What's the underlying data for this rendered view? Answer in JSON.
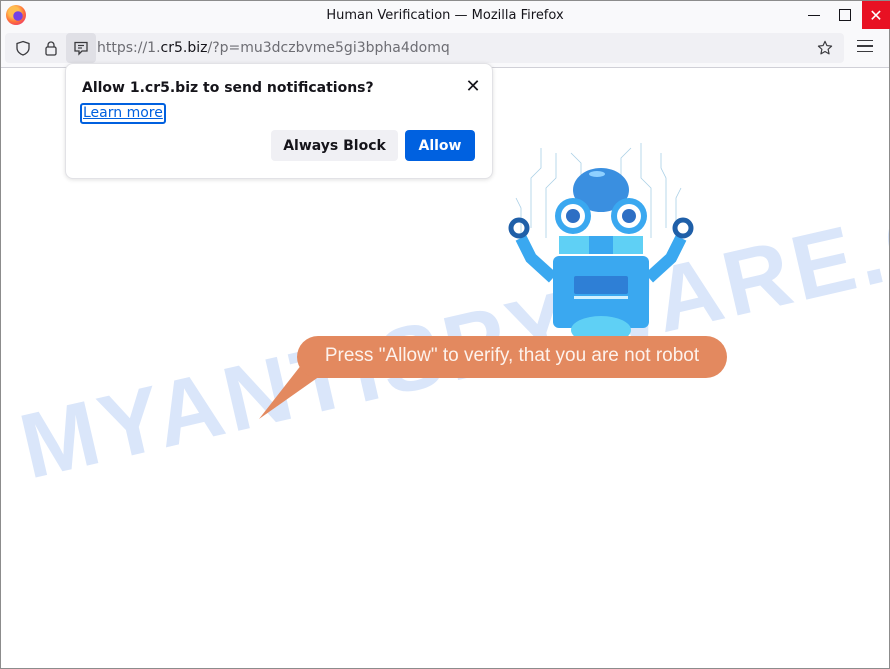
{
  "window": {
    "title": "Human Verification — Mozilla Firefox",
    "minimize_label": "Minimize",
    "maximize_label": "Maximize",
    "close_label": "Close"
  },
  "navbar": {
    "url_scheme": "https://1.",
    "url_host": "cr5.biz",
    "url_path": "/?p=mu3dczbvme5gi3bpha4domq",
    "icons": [
      "shield-icon",
      "lock-icon",
      "notification-permission-icon",
      "bookmark-star-icon",
      "hamburger-menu-icon"
    ]
  },
  "popup": {
    "title": "Allow 1.cr5.biz to send notifications?",
    "learn_more": "Learn more",
    "block_label": "Always Block",
    "allow_label": "Allow"
  },
  "page": {
    "bubble_text": "Press \"Allow\" to verify, that you are not robot",
    "watermark": "MYANTISPYWARE.COM",
    "colors": {
      "bubble": "#e3895f",
      "allow_button": "#0061e0",
      "robot_primary": "#3aa8f0",
      "close_button": "#e81123"
    }
  }
}
